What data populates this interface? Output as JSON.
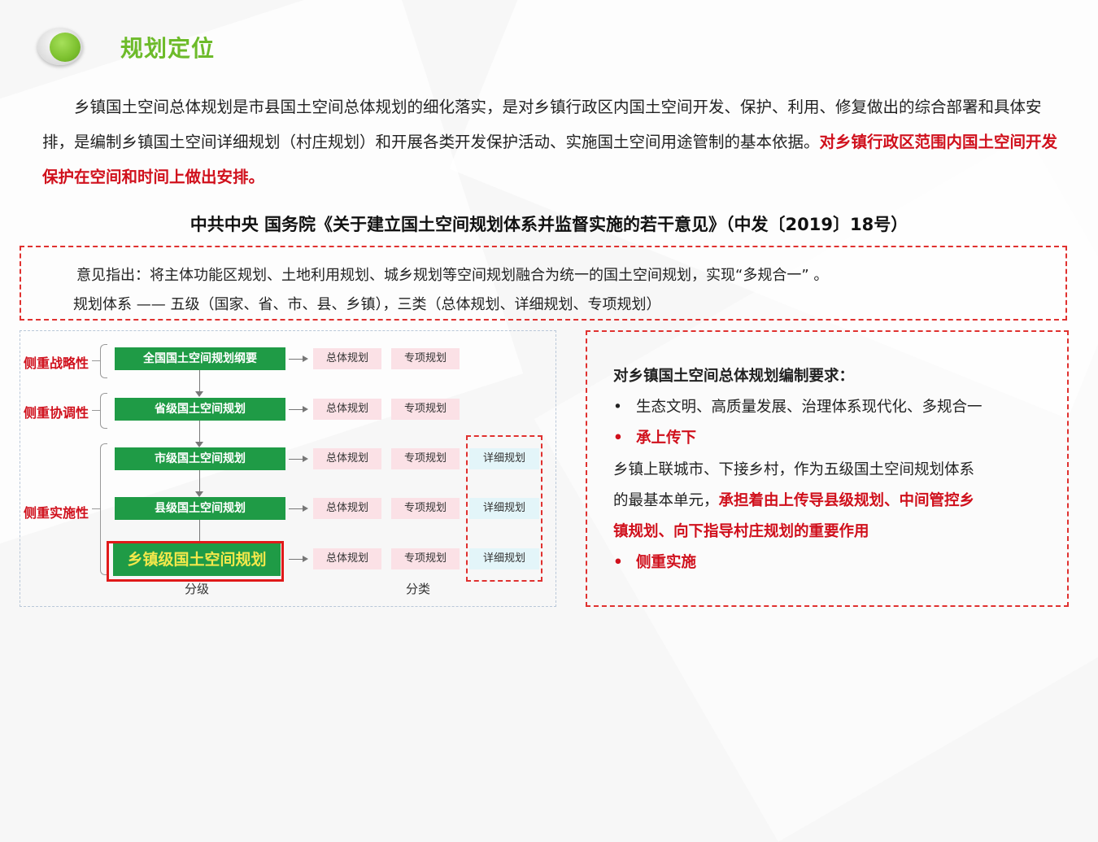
{
  "header": {
    "title": "规划定位"
  },
  "intro": {
    "text": "乡镇国土空间总体规划是市县国土空间总体规划的细化落实，是对乡镇行政区内国土空间开发、保护、利用、修复做出的综合部署和具体安排，是编制乡镇国土空间详细规划（村庄规划）和开展各类开发保护活动、实施国土空间用途管制的基本依据。",
    "highlight": "对乡镇行政区范围内国土空间开发保护在空间和时间上做出安排。"
  },
  "doc_title": "中共中央  国务院《关于建立国土空间规划体系并监督实施的若干意见》（中发〔2019〕18号）",
  "opinion": {
    "line1": "意见指出：将主体功能区规划、土地利用规划、城乡规划等空间规划融合为统一的国土空间规划，实现“多规合一” 。",
    "line2": "规划体系 —— 五级（国家、省、市、县、乡镇），三类（总体规划、详细规划、专项规划）"
  },
  "diagram": {
    "labels": [
      "侧重战略性",
      "侧重协调性",
      "侧重实施性"
    ],
    "levels": [
      "全国国土空间规划纲要",
      "省级国土空间规划",
      "市级国土空间规划",
      "县级国土空间规划",
      "乡镇级国土空间规划"
    ],
    "overall": "总体规划",
    "special": "专项规划",
    "detailed": "详细规划",
    "caption_levels": "分级",
    "caption_types": "分类"
  },
  "requirements": {
    "heading": "对乡镇国土空间总体规划编制要求：",
    "bullet1": "生态文明、高质量发展、治理体系现代化、多规合一",
    "bullet2": "承上传下",
    "para1": "乡镇上联城市、下接乡村，作为五级国土空间规划体系",
    "para2_normal": "的最基本单元，",
    "para2_red": "承担着由上传导县级规划、中间管控乡",
    "para3_red": "镇规划、向下指导村庄规划的重要作用",
    "bullet3": "侧重实施",
    "bullet_symbol": "•"
  },
  "colors": {
    "accent_green": "#6dbb2a",
    "highlight_red": "#d0101c",
    "box_green": "#1f9b46"
  }
}
